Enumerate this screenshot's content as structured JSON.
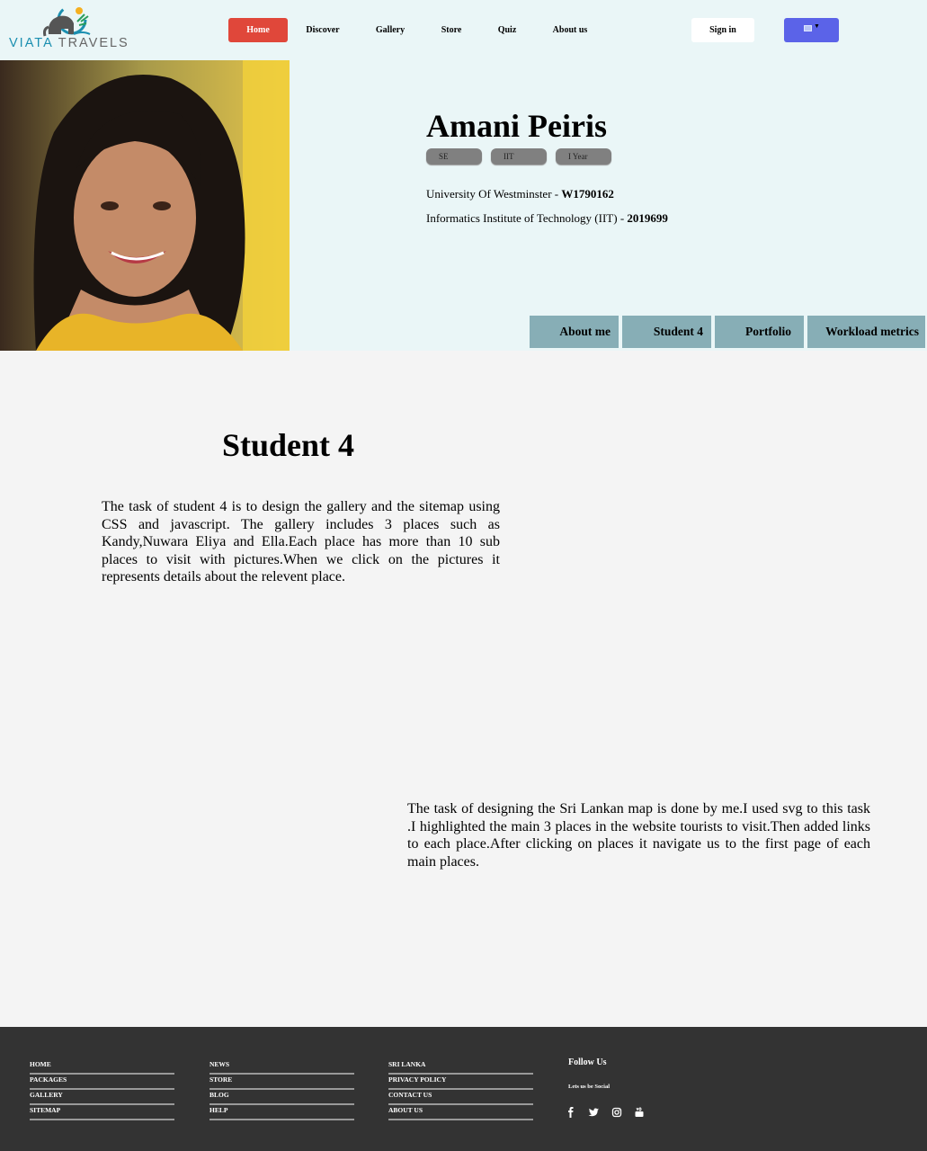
{
  "brand": {
    "name_part1": "VIATA",
    "name_part2": " TRAVELS"
  },
  "nav": {
    "items": [
      "Home",
      "Discover",
      "Gallery",
      "Store",
      "Quiz",
      "About us"
    ],
    "active": "Home",
    "signin_label": "Sign in",
    "language_icon": "flag-icon"
  },
  "profile": {
    "name": "Amani Peiris",
    "badges": [
      "SE",
      "IIT",
      "I Year"
    ],
    "edu1_text": "University Of Westminster - ",
    "edu1_id": "W1790162",
    "edu2_text": "Informatics Institute of Technology (IIT) - ",
    "edu2_id": "2019699"
  },
  "tabs": [
    "About me",
    "Student 4",
    "Portfolio",
    "Workload metrics"
  ],
  "main": {
    "title": "Student 4",
    "para1": "The task of student 4 is to design the gallery and the sitemap using CSS and javascript. The gallery includes 3 places such as Kandy,Nuwara Eliya and Ella.Each place has more than 10 sub places to visit with pictures.When we click on the pictures it represents details about the relevent place.",
    "para2": "The task of designing the Sri Lankan map is done by me.I used svg to this task .I highlighted the main 3 places in the website tourists to visit.Then added links to each place.After clicking on places it navigate us to the first page of each main places."
  },
  "footer": {
    "col1": [
      "HOME",
      "PACKAGES",
      "GALLERY",
      "SITEMAP"
    ],
    "col2": [
      "NEWS",
      "STORE",
      "BLOG",
      "HELP"
    ],
    "col3": [
      "SRI LANKA",
      "PRIVACY POLICY",
      "CONTACT US",
      "ABOUT US"
    ],
    "follow_title": "Follow Us",
    "follow_sub": "Lets us be Social",
    "social_icons": [
      "facebook-icon",
      "twitter-icon",
      "instagram-icon",
      "youtube-icon"
    ]
  },
  "colors": {
    "header_bg": "#eaf6f7",
    "accent_red": "#e0473a",
    "lang_blue": "#5b63e8",
    "tab_bg": "#87aeb6",
    "footer_bg": "#333333"
  }
}
